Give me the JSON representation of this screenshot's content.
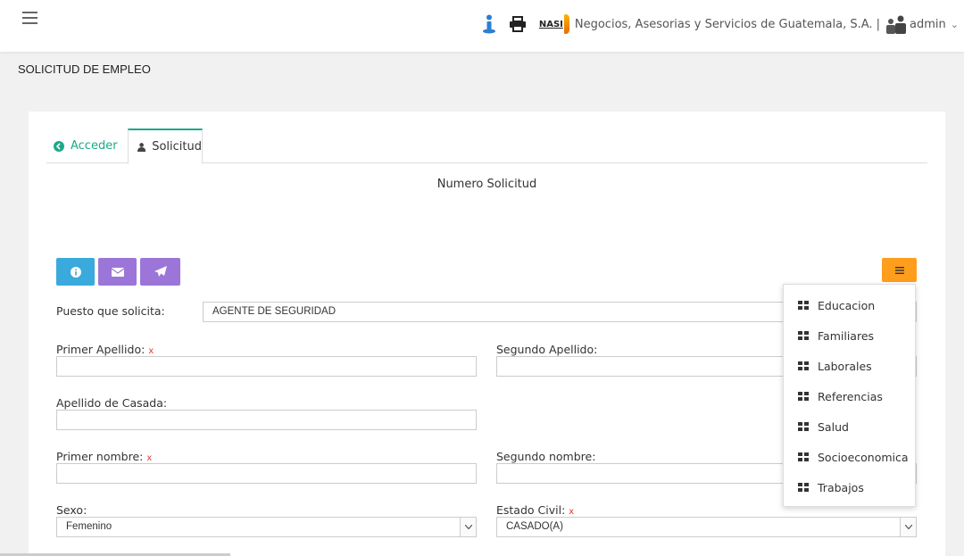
{
  "header": {
    "logo_text": "NASI",
    "company": "Negocios, Asesorias y Servicios de Guatemala, S.A. |",
    "user": "admin",
    "icons": [
      "hamburger-icon",
      "person-info-icon",
      "printer-icon",
      "users-icon",
      "chevron-down-icon"
    ],
    "accent_color": "#2b7fd4"
  },
  "page": {
    "title": "SOLICITUD DE EMPLEO"
  },
  "tabs": [
    {
      "label": "Acceder",
      "icon": "arrow-circle-left-icon",
      "active": false
    },
    {
      "label": "Solicitud",
      "icon": "user-icon",
      "active": true
    }
  ],
  "main": {
    "numero_label": "Numero Solicitud",
    "action_buttons": [
      {
        "icon": "info-icon",
        "color": "#3aa9dc"
      },
      {
        "icon": "envelope-icon",
        "color": "#9b76d8"
      },
      {
        "icon": "paper-plane-icon",
        "color": "#9b76d8"
      }
    ],
    "menu_button_color": "#ff9d1c"
  },
  "form": {
    "puesto_label": "Puesto que solicita:",
    "puesto_value": "AGENTE DE SEGURIDAD",
    "primer_apellido_label": "Primer Apellido:",
    "segundo_apellido_label": "Segundo Apellido:",
    "apellido_casada_label": "Apellido de Casada:",
    "primer_nombre_label": "Primer nombre:",
    "segundo_nombre_label": "Segundo nombre:",
    "sexo_label": "Sexo:",
    "sexo_value": "Femenino",
    "estado_civil_label": "Estado Civil:",
    "estado_civil_value": "CASADO(A)",
    "required_mark": "x"
  },
  "dropdown": {
    "items": [
      "Educacion",
      "Familiares",
      "Laborales",
      "Referencias",
      "Salud",
      "Socioeconomica",
      "Trabajos"
    ]
  }
}
